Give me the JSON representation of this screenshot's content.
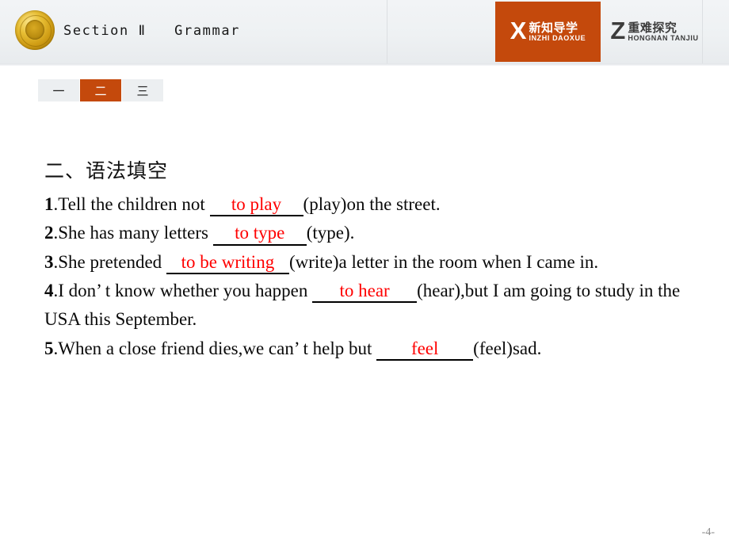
{
  "header": {
    "emblem_label": "gold-seal-emblem",
    "section_title": "Section Ⅱ   Grammar",
    "badges": [
      {
        "letter": "X",
        "cn": "新知导学",
        "en": "INZHI DAOXUE",
        "active": true,
        "color": "#c4490c"
      },
      {
        "letter": "Z",
        "cn": "重难探究",
        "en": "HONGNAN TANJIU",
        "active": false,
        "color": "#3c3c3c"
      }
    ]
  },
  "tabs": [
    {
      "label": "一",
      "active": false
    },
    {
      "label": "二",
      "active": true
    },
    {
      "label": "三",
      "active": false
    }
  ],
  "content": {
    "heading": "二、语法填空",
    "answer_color": "#ff0000",
    "questions": [
      {
        "num": "1",
        "pre": ".Tell the children not ",
        "answer": "to play",
        "post": "(play)on the street."
      },
      {
        "num": "2",
        "pre": ".She has many letters ",
        "answer": "to type",
        "post": "(type)."
      },
      {
        "num": "3",
        "pre": ".She pretended ",
        "answer": "to be writing",
        "post": "(write)a letter in the room when I came in."
      },
      {
        "num": "4",
        "pre": ".I don’ t know whether you happen ",
        "answer": "to hear",
        "post": "(hear),but I am going to study in the USA this September."
      },
      {
        "num": "5",
        "pre": ".When a close friend dies,we can’ t help but ",
        "answer": "feel",
        "post": "(feel)sad."
      }
    ]
  },
  "footer": {
    "page_number": "-4-"
  }
}
